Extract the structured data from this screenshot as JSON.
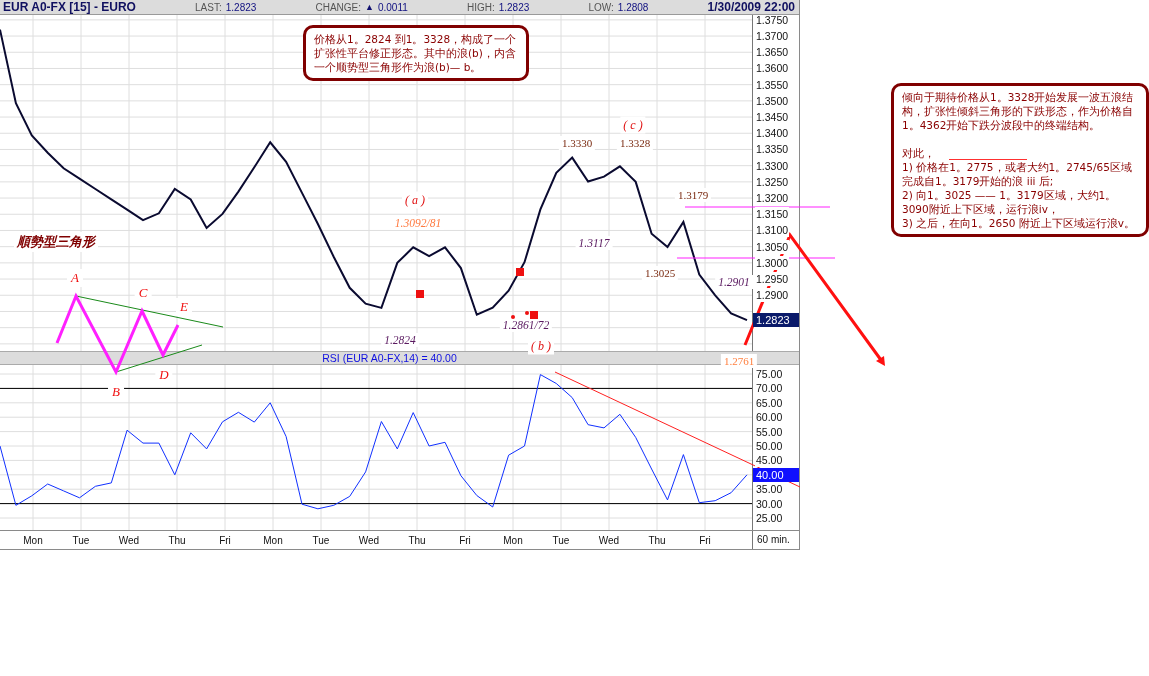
{
  "header": {
    "symbol": "EUR A0-FX [15] - EURO",
    "last": {
      "label": "LAST:",
      "value": "1.2823"
    },
    "change": {
      "label": "CHANGE:",
      "arrow": "▲",
      "value": "0.0011"
    },
    "high": {
      "label": "HIGH:",
      "value": "1.2823"
    },
    "low": {
      "label": "LOW:",
      "value": "1.2808"
    },
    "datetime": "1/30/2009 22:00"
  },
  "price_pane": {
    "chart_data": {
      "type": "line",
      "grid": true,
      "ylim": [
        1.2728,
        1.3765
      ],
      "series": [
        {
          "color": "#0a0a30",
          "values": [
            1.372,
            1.3493,
            1.3393,
            1.334,
            1.3292,
            1.326,
            1.3228,
            1.3196,
            1.3164,
            1.3132,
            1.3153,
            1.3228,
            1.3196,
            1.3108,
            1.3151,
            1.322,
            1.3295,
            1.3372,
            1.3312,
            1.3216,
            1.312,
            1.3018,
            1.2923,
            1.2874,
            1.2861,
            1.3,
            1.3048,
            1.3021,
            1.3048,
            1.2984,
            1.284,
            1.2862,
            1.2914,
            1.3002,
            1.3165,
            1.3278,
            1.3325,
            1.3251,
            1.3266,
            1.3298,
            1.325,
            1.309,
            1.3049,
            1.3126,
            1.2964,
            1.29,
            1.2844,
            1.2823
          ]
        }
      ],
      "yticks": [
        {
          "value": 1.375,
          "label": "1.3750"
        },
        {
          "value": 1.37,
          "label": "1.3700"
        },
        {
          "value": 1.365,
          "label": "1.3650"
        },
        {
          "value": 1.36,
          "label": "1.3600"
        },
        {
          "value": 1.355,
          "label": "1.3550"
        },
        {
          "value": 1.35,
          "label": "1.3500"
        },
        {
          "value": 1.345,
          "label": "1.3450"
        },
        {
          "value": 1.34,
          "label": "1.3400"
        },
        {
          "value": 1.335,
          "label": "1.3350"
        },
        {
          "value": 1.33,
          "label": "1.3300"
        },
        {
          "value": 1.325,
          "label": "1.3250"
        },
        {
          "value": 1.32,
          "label": "1.3200"
        },
        {
          "value": 1.315,
          "label": "1.3150"
        },
        {
          "value": 1.31,
          "label": "1.3100"
        },
        {
          "value": 1.305,
          "label": "1.3050"
        },
        {
          "value": 1.3,
          "label": "1.3000"
        },
        {
          "value": 1.295,
          "label": "1.2950"
        },
        {
          "value": 1.29,
          "label": "1.2900"
        }
      ]
    },
    "current_price": "1.2823",
    "annotations": [
      {
        "text": "( c )",
        "kind": "wave"
      },
      {
        "text": "1.3330",
        "kind": "peak"
      },
      {
        "text": "1.3328",
        "kind": "peak"
      },
      {
        "text": "1.3179",
        "kind": "peak"
      },
      {
        "text": "( a )",
        "kind": "wave"
      },
      {
        "text": "1.3092/81",
        "kind": "pivot"
      },
      {
        "text": "1.3117",
        "kind": "swing"
      },
      {
        "text": "1.3025",
        "kind": "peak"
      },
      {
        "text": "1.2901",
        "kind": "swing"
      },
      {
        "text": "1.2861/72",
        "kind": "swing"
      },
      {
        "text": "1.2824",
        "kind": "swing"
      },
      {
        "text": "( b )",
        "kind": "wave"
      },
      {
        "text": "1.2761",
        "kind": "target"
      }
    ]
  },
  "pattern": {
    "title": "順勢型三角形",
    "points": [
      "A",
      "B",
      "C",
      "D",
      "E"
    ]
  },
  "rsi_pane": {
    "title": "RSI (EUR A0-FX,14) = 40.00",
    "chart_data": {
      "type": "line",
      "grid": true,
      "ylim": [
        20.83,
        78.13
      ],
      "series": [
        {
          "color": "#1030ff",
          "values": [
            50,
            29.4,
            32.7,
            36.8,
            34.4,
            32,
            36,
            37.2,
            55.5,
            51,
            51,
            40,
            54.6,
            49,
            58.4,
            61.7,
            58.3,
            65,
            53.3,
            29.8,
            28.2,
            29.4,
            32.5,
            41,
            58.5,
            49,
            61.6,
            50,
            51.3,
            39.7,
            32.8,
            28.8,
            46.8,
            50,
            74.8,
            71.7,
            66.8,
            57.4,
            56.3,
            61,
            53,
            42,
            31.3,
            47,
            30.3,
            31,
            33.8,
            40
          ]
        }
      ],
      "yticks": [
        {
          "value": 75,
          "label": "75.00"
        },
        {
          "value": 70,
          "label": "70.00"
        },
        {
          "value": 65,
          "label": "65.00"
        },
        {
          "value": 60,
          "label": "60.00"
        },
        {
          "value": 55,
          "label": "55.00"
        },
        {
          "value": 50,
          "label": "50.00"
        },
        {
          "value": 45,
          "label": "45.00"
        },
        {
          "value": 35,
          "label": "35.00"
        },
        {
          "value": 30,
          "label": "30.00"
        },
        {
          "value": 25,
          "label": "25.00"
        }
      ]
    },
    "current_value": "40.00"
  },
  "time_axis": {
    "labels": [
      "Mon",
      "Tue",
      "Wed",
      "Thu",
      "Fri",
      "Mon",
      "Tue",
      "Wed",
      "Thu",
      "Fri",
      "Mon",
      "Tue",
      "Wed",
      "Thu",
      "Fri"
    ],
    "interval": "60 min."
  },
  "notes": [
    {
      "paragraphs": [
        {
          "text": "价格从1。2824 到1。3328，构成了一个扩张性平台修正形态。其中的浪(b)，内含一个顺势型三角形作为浪(b)— b。"
        }
      ]
    },
    {
      "paragraphs": [
        {
          "text": "倾向于期待价格从1。3328开始发展一波五浪结构，扩张性倾斜三角形的下跌形态，作为价格自1。4362开始下跌分波段中的终端结构。"
        },
        {
          "text": "对此，"
        },
        {
          "text": "1) 价格在",
          "struck": "1。2775，或者",
          "after": "大约1。2745/65区域完成自1。3179开始的浪 iii 后;"
        },
        {
          "text": "2) 向1。3025 —— 1。3179区域，大约1。3090附近上下区域，运行浪iv，"
        },
        {
          "text": "3) 之后，在向1。2650 附近上下区域运行浪v。"
        }
      ]
    }
  ]
}
